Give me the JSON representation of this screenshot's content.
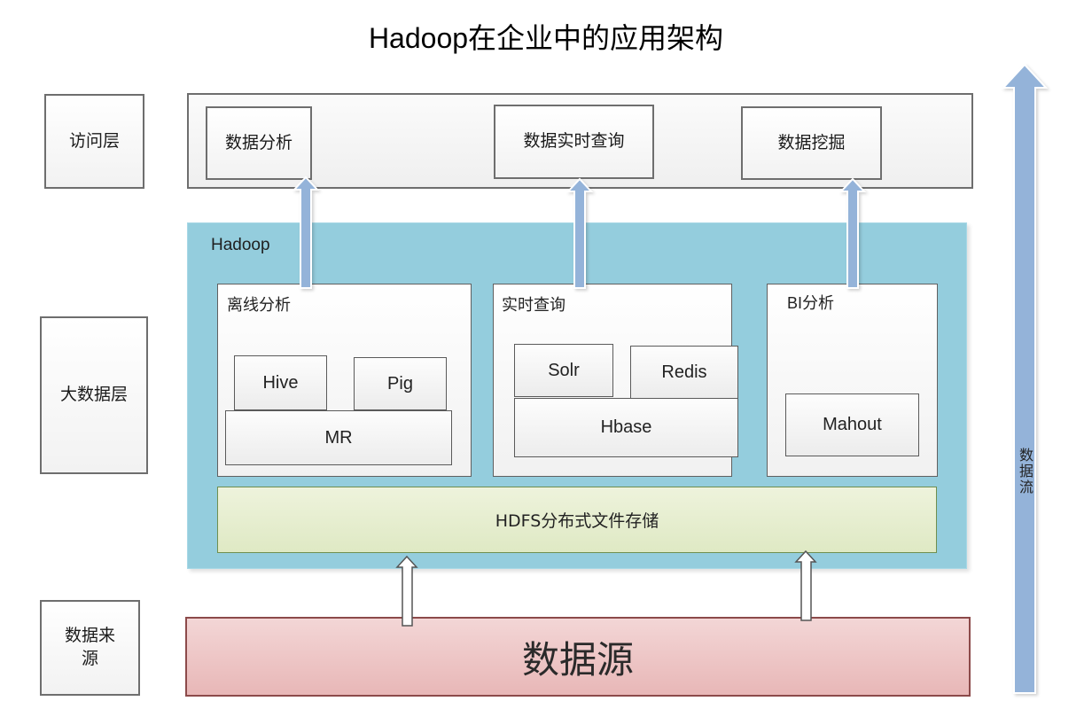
{
  "title": "Hadoop在企业中的应用架构",
  "layers": {
    "access": "访问层",
    "bigdata": "大数据层",
    "source": "数据来源"
  },
  "access_layer": {
    "items": [
      "数据分析",
      "数据实时查询",
      "数据挖掘"
    ]
  },
  "hadoop": {
    "label": "Hadoop",
    "sections": {
      "offline": {
        "label": "离线分析",
        "components": {
          "hive": "Hive",
          "pig": "Pig",
          "mr": "MR"
        }
      },
      "realtime": {
        "label": "实时查询",
        "components": {
          "solr": "Solr",
          "redis": "Redis",
          "hbase": "Hbase"
        }
      },
      "bi": {
        "label": "BI分析",
        "components": {
          "mahout": "Mahout"
        }
      }
    },
    "hdfs": "HDFS分布式文件存储"
  },
  "data_source": "数据源",
  "data_flow_label": "数据流",
  "colors": {
    "hadoop_bg": "#94cddd",
    "hdfs_bg": "#e6eecf",
    "source_bg": "#eec6c6",
    "arrow_blue": "#94b3d9"
  }
}
